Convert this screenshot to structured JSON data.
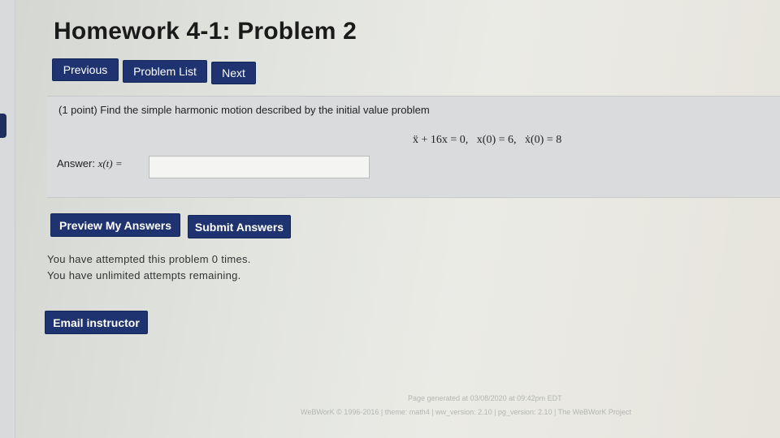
{
  "page": {
    "title": "Homework 4-1: Problem 2"
  },
  "nav": {
    "previous": "Previous",
    "problem_list": "Problem List",
    "next": "Next"
  },
  "problem": {
    "intro": "(1 point) Find the simple harmonic motion described by the initial value problem",
    "equation": "ẍ + 16x = 0,   x(0) = 6,   ẋ(0) = 8",
    "answer_prefix": "Answer: ",
    "answer_math": "x(t) =",
    "answer_value": "",
    "answer_placeholder": ""
  },
  "actions": {
    "preview": "Preview My Answers",
    "submit": "Submit Answers"
  },
  "status": {
    "attempts": "You have attempted this problem 0 times.",
    "remaining": "You have unlimited attempts remaining."
  },
  "email": {
    "label": "Email instructor"
  },
  "footer": {
    "generated": "Page generated at 03/08/2020 at 09:42pm EDT",
    "copyright": "WeBWorK © 1996-2016 | theme: math4 | ww_version: 2.10 | pg_version: 2.10 | The WeBWorK Project"
  }
}
